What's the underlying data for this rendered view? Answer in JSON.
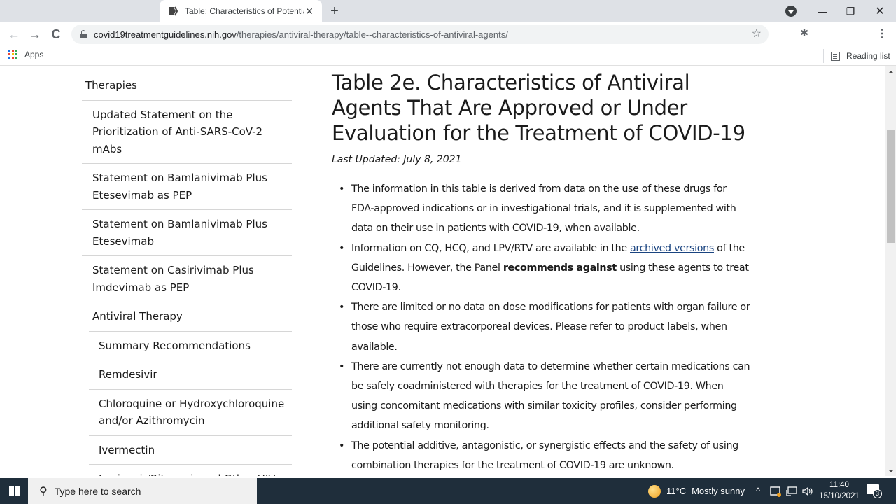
{
  "browser": {
    "tab": {
      "title": "Table: Characteristics of Potential"
    },
    "new_tab_label": "+",
    "address": {
      "domain": "covid19treatmentguidelines.nih.gov",
      "path": "/therapies/antiviral-therapy/table--characteristics-of-antiviral-agents/"
    },
    "bookmarks": {
      "apps_label": "Apps",
      "reading_list_label": "Reading list"
    },
    "icons": {
      "back": "←",
      "forward": "→",
      "reload": "C",
      "star": "☆",
      "extensions": "✱",
      "menu": "⋮",
      "minimize": "—",
      "restore": "❐",
      "close": "✕",
      "tab_close": "✕"
    }
  },
  "sidebar": {
    "items": [
      {
        "label": "Therapies",
        "level": 1
      },
      {
        "label": "Updated Statement on the Prioritization of Anti-SARS-CoV-2 mAbs",
        "level": 2
      },
      {
        "label": "Statement on Bamlanivimab Plus Etesevimab as PEP",
        "level": 2
      },
      {
        "label": "Statement on Bamlanivimab Plus Etesevimab",
        "level": 2
      },
      {
        "label": "Statement on Casirivimab Plus Imdevimab as PEP",
        "level": 2
      },
      {
        "label": "Antiviral Therapy",
        "level": 2
      },
      {
        "label": "Summary Recommendations",
        "level": 3
      },
      {
        "label": "Remdesivir",
        "level": 3
      },
      {
        "label": "Chloroquine or Hydroxychloroquine and/or Azithromycin",
        "level": 3
      },
      {
        "label": "Ivermectin",
        "level": 3
      },
      {
        "label": "Lopinavir/Ritonavir and Other HIV",
        "level": 3
      }
    ]
  },
  "main": {
    "title": "Table 2e. Characteristics of Antiviral Agents That Are Approved or Under Evaluation for the Treatment of COVID-19",
    "last_updated": "Last Updated: July 8, 2021",
    "bullets": {
      "b1": "The information in this table is derived from data on the use of these drugs for FDA-approved indications or in investigational trials, and it is supplemented with data on their use in patients with COVID-19, when available.",
      "b2_pre": "Information on CQ, HCQ, and LPV/RTV are available in the ",
      "b2_link": "archived versions",
      "b2_mid": " of the Guidelines. However, the Panel ",
      "b2_bold": "recommends against",
      "b2_post": " using these agents to treat COVID-19.",
      "b3": "There are limited or no data on dose modifications for patients with organ failure or those who require extracorporeal devices. Please refer to product labels, when available.",
      "b4": "There are currently not enough data to determine whether certain medications can be safely coadministered with therapies for the treatment of COVID-19. When using concomitant medications with similar toxicity profiles, consider performing additional safety monitoring.",
      "b5": "The potential additive, antagonistic, or synergistic effects and the safety of using combination therapies for the treatment of COVID-19 are unknown."
    }
  },
  "scrollbar": {
    "position_fraction": 0.16
  },
  "taskbar": {
    "search_placeholder": "Type here to search",
    "weather": {
      "temp": "11°C",
      "condition": "Mostly sunny"
    },
    "tray_chevron": "^",
    "time": "11:40",
    "date": "15/10/2021",
    "notification_count": "3"
  }
}
